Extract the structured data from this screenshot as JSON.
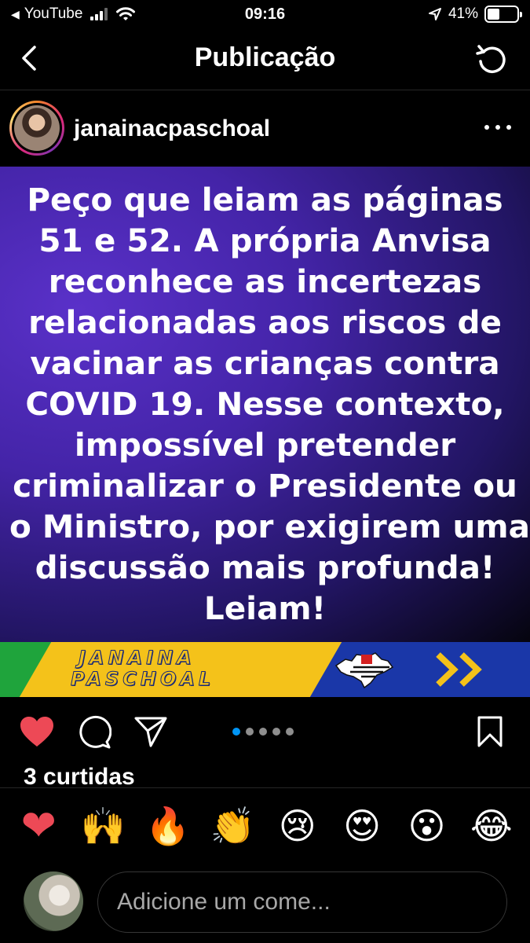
{
  "status_bar": {
    "back_app": "YouTube",
    "time": "09:16",
    "battery": "41%",
    "battery_fraction": 0.41,
    "icons": [
      "signal-icon",
      "wifi-icon",
      "location-icon",
      "battery-icon"
    ]
  },
  "nav": {
    "title": "Publicação",
    "icons": [
      "back-arrow-icon",
      "refresh-icon"
    ]
  },
  "post": {
    "username": "janainacpaschoal",
    "text_lines": [
      "Peço que leiam as páginas",
      "51 e 52. A própria Anvisa",
      "reconhece as incertezas",
      "relacionadas aos riscos de",
      "vacinar as crianças contra",
      "COVID 19. Nesse contexto,",
      "impossível pretender",
      "criminalizar o Presidente ou",
      "o Ministro, por exigirem uma",
      "discussão mais profunda!",
      "Leiam!"
    ],
    "banner": {
      "name_line1": "JANAINA",
      "name_line2": "PASCHOAL",
      "colors": {
        "blue": "#1a37a8",
        "yellow": "#f4c21a",
        "green": "#1fa43c"
      }
    },
    "carousel": {
      "count": 5,
      "active_index": 0
    },
    "likes": "3 curtidas"
  },
  "composer": {
    "emojis": [
      "❤️",
      "🙌",
      "🔥",
      "👏",
      "😢",
      "😍",
      "😮",
      "😂"
    ],
    "placeholder": "Adicione um come..."
  },
  "colors": {
    "like": "#ed4956",
    "active_dot": "#0095f6",
    "background": "#000000"
  }
}
